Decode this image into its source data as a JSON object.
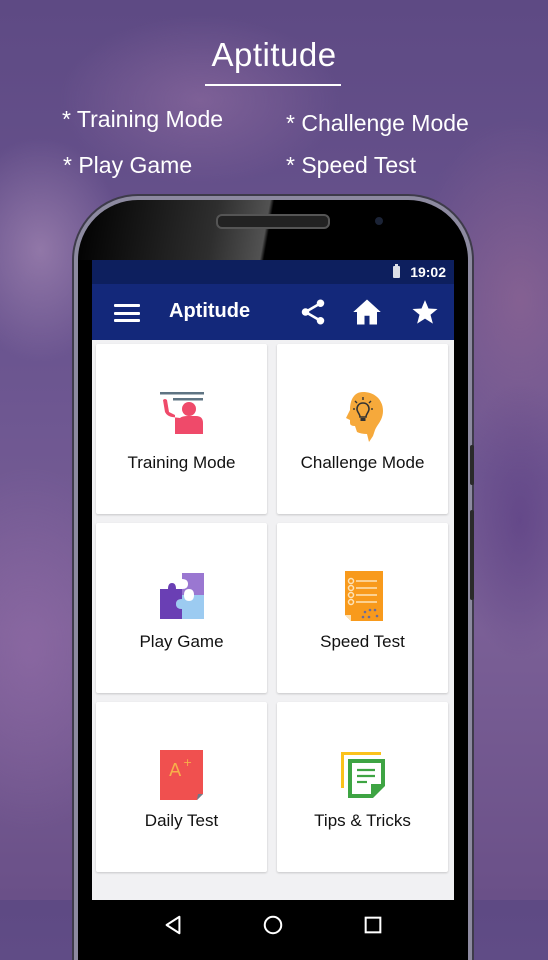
{
  "promo": {
    "title": "Aptitude",
    "features": [
      "* Training Mode",
      "* Challenge Mode",
      "* Play Game",
      "* Speed Test"
    ]
  },
  "status_bar": {
    "time": "19:02",
    "icons": [
      "battery-icon"
    ]
  },
  "app_bar": {
    "title": "Aptitude",
    "actions": [
      "menu-icon",
      "share-icon",
      "home-icon",
      "star-icon"
    ],
    "color": "#13287a",
    "status_color": "#0d1f5e"
  },
  "menu": {
    "items": [
      {
        "label": "Training Mode",
        "icon": "teacher-board-icon"
      },
      {
        "label": "Challenge Mode",
        "icon": "head-lightbulb-icon"
      },
      {
        "label": "Play Game",
        "icon": "puzzle-icon"
      },
      {
        "label": "Speed Test",
        "icon": "checklist-document-icon"
      },
      {
        "label": "Daily Test",
        "icon": "a-plus-grade-icon"
      },
      {
        "label": "Tips & Tricks",
        "icon": "sticky-notes-icon"
      }
    ]
  },
  "nav_bar": {
    "buttons": [
      "back-icon",
      "home-circle-icon",
      "recent-apps-icon"
    ]
  }
}
